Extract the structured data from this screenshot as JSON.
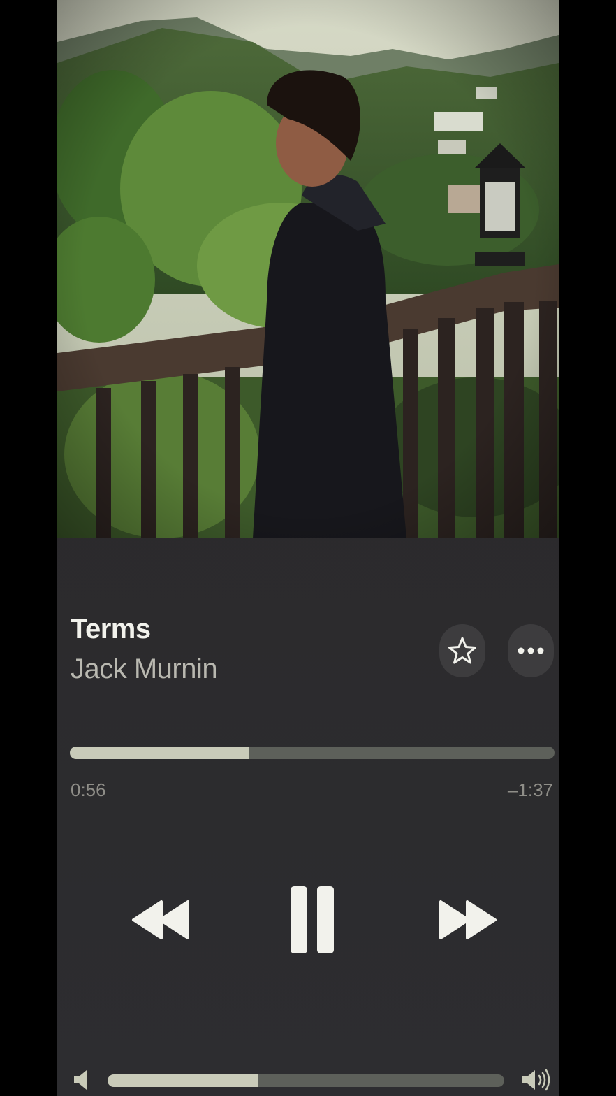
{
  "now_playing": {
    "title": "Terms",
    "artist": "Jack Murnin",
    "elapsed": "0:56",
    "remaining": "–1:37",
    "progress_fraction": 0.37
  },
  "actions": {
    "favorite_icon": "star-icon",
    "more_icon": "ellipsis-icon"
  },
  "transport": {
    "previous_icon": "rewind-icon",
    "play_state_icon": "pause-icon",
    "next_icon": "fast-forward-icon"
  },
  "volume": {
    "level_fraction": 0.38,
    "low_icon": "speaker-low-icon",
    "high_icon": "speaker-high-icon"
  },
  "colors": {
    "background": "#2b2a2c",
    "bar_fill": "#c9cbb9",
    "bar_track": "#5d605a",
    "title_text": "#f2f2ec",
    "secondary_text": "#8f8e88"
  }
}
